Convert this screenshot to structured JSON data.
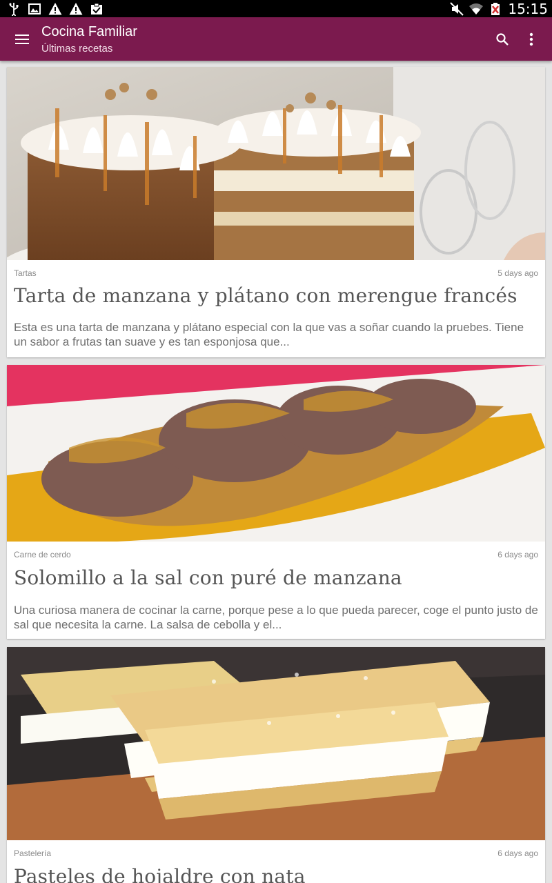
{
  "status_bar": {
    "time": "15:15",
    "icons": [
      "usb-icon",
      "image-icon",
      "warning-icon",
      "warning-icon",
      "clipboard-check-icon",
      "mute-icon",
      "wifi-icon",
      "battery-alert-icon"
    ]
  },
  "app_bar": {
    "title": "Cocina Familiar",
    "subtitle": "Últimas recetas",
    "icons": [
      "menu-icon",
      "search-icon",
      "more-vert-icon"
    ],
    "color": "#7b1a4e"
  },
  "recipes": [
    {
      "category": "Tartas",
      "date": "5 days ago",
      "title": "Tarta de manzana y plátano con merengue francés",
      "excerpt": "Esta es una tarta de manzana y plátano especial con la que vas a soñar cuando la pruebes. Tiene un sabor a frutas tan suave y es tan esponjosa que..."
    },
    {
      "category": "Carne de cerdo",
      "date": "6 days ago",
      "title": "Solomillo a la sal con puré de manzana",
      "excerpt": "Una curiosa manera de cocinar la carne, porque pese a lo que pueda parecer, coge el punto justo de sal que necesita la carne. La salsa de cebolla y el..."
    },
    {
      "category": "Pastelería",
      "date": "6 days ago",
      "title": "Pasteles de hojaldre con nata",
      "excerpt": ""
    }
  ]
}
